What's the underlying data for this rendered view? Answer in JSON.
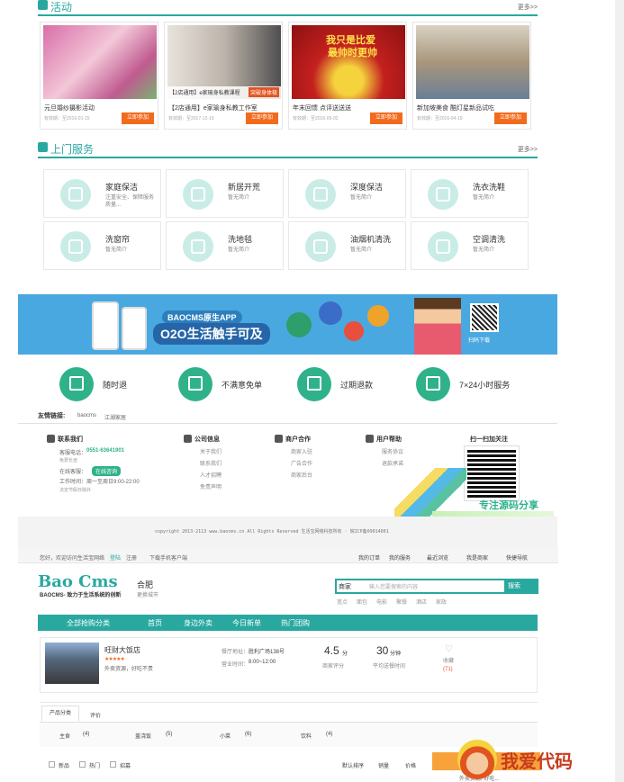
{
  "activity": {
    "title": "活动",
    "more": "更多>>",
    "items": [
      {
        "name": "元旦婚纱摄影活动",
        "date": "有效期：至2016-01-15",
        "btn": "立即参加",
        "c1": "#d86fa8",
        "c2": "#f3c7d8"
      },
      {
        "name": "【2店通用】e家瑜身私教工作室",
        "date": "有效期：至2017-12-19",
        "btn": "立即参加",
        "c1": "#cfc7bf",
        "c2": "#5a5a5a"
      },
      {
        "name": "年末回馈 点评送送送",
        "date": "有效期：至2016-05-02",
        "btn": "立即参加",
        "c1": "#c4201f",
        "c2": "#f5d33c"
      },
      {
        "name": "新加坡美食 酷灯星新品试吃",
        "date": "有效期：至2016-04-19",
        "btn": "立即参加",
        "c1": "#c1a987",
        "c2": "#6a7f96"
      }
    ],
    "overlay_texts": [
      "【2店通用】e家瑜身私教课程",
      "突破身体极",
      "我只是比爱",
      "最帅时更帅"
    ]
  },
  "services": {
    "title": "上门服务",
    "more": "更多>>",
    "items": [
      {
        "name": "家庭保洁",
        "desc": "注重安全、保障服务质量..."
      },
      {
        "name": "新居开荒",
        "desc": "暂无简介"
      },
      {
        "name": "深度保洁",
        "desc": "暂无简介"
      },
      {
        "name": "洗衣洗鞋",
        "desc": "暂无简介"
      },
      {
        "name": "洗窗帘",
        "desc": "暂无简介"
      },
      {
        "name": "洗地毯",
        "desc": "暂无简介"
      },
      {
        "name": "油烟机清洗",
        "desc": "暂无简介"
      },
      {
        "name": "空调清洗",
        "desc": "暂无简介"
      }
    ]
  },
  "banner": {
    "app": "BAOCMS原生APP",
    "slogan": "O2O生活触手可及",
    "qr_label": "扫码下载"
  },
  "guarantees": [
    {
      "label": "随时退"
    },
    {
      "label": "不满意免单"
    },
    {
      "label": "过期退款"
    },
    {
      "label": "7×24小时服务"
    }
  ],
  "friend_links": {
    "label": "友情链接:",
    "items": [
      "baocms",
      "江湖家居"
    ]
  },
  "footer": {
    "contact": {
      "title": "联系我们",
      "phone_label": "客服电话：",
      "phone": "0551-63641901",
      "phone_note": "免费长途",
      "online_label": "在线客服：",
      "online_btn": "在线咨询",
      "hours_label": "工作时间：",
      "hours": "周一至周日9:00-22:00",
      "note": "法定节假日除外"
    },
    "columns": [
      {
        "title": "公司信息",
        "links": [
          "关于我们",
          "联系我们",
          "人才招聘",
          "免责声明"
        ]
      },
      {
        "title": "商户合作",
        "links": [
          "商家入驻",
          "广告合作",
          "商家后台"
        ]
      },
      {
        "title": "用户帮助",
        "links": [
          "服务协议",
          "退款承诺"
        ]
      }
    ],
    "qr_title": "扫一扫加关注",
    "copyright": "copyright 2013-2113 www.baocms.cn All Rights Reserved 生活宝网络科技所有 · 皖ICP备09014001",
    "watermark": "专注源码分享"
  },
  "shop": {
    "topbar": {
      "welcome": "您好，欢迎访问生活宝网络",
      "login": "登陆",
      "register": "注册",
      "mobile": "下载手机客户端",
      "links": [
        "我的订单",
        "我的服务",
        "最近浏览",
        "我是商家",
        "快捷导航"
      ]
    },
    "logo": "Bao Cms",
    "logo_sub": "BAOCMS- 致力于生活系统的创新",
    "city": "合肥",
    "city_switch": "更换城市",
    "search": {
      "scope": "商家",
      "placeholder": "输入您要搜索的内容",
      "button": "搜索",
      "hot": [
        "宽点",
        "面包",
        "电影",
        "聚餐",
        "酒店",
        "家政"
      ]
    },
    "nav": [
      "全部抢购分类",
      "首页",
      "身边外卖",
      "今日新单",
      "热门团购"
    ],
    "store": {
      "name": "旺财大饭店",
      "tags": "外卖资源，好吃不贵",
      "address_label": "餐厅地址：",
      "address": "胜利广场138号",
      "hours_label": "营业时间：",
      "hours": "8:00~12:00",
      "rating": "4.5",
      "rating_unit": "分",
      "rating_label": "商家评分",
      "delivery": "30",
      "delivery_unit": "分钟",
      "delivery_label": "平均送餐时间",
      "fav": "收藏",
      "fav_count": "(71)"
    },
    "tabs": [
      "产品分类",
      "评价"
    ],
    "categories": [
      {
        "name": "主食",
        "count": "(4)"
      },
      {
        "name": "盖浇饭",
        "count": "(5)"
      },
      {
        "name": "小菜",
        "count": "(6)"
      },
      {
        "name": "饮料",
        "count": "(4)"
      }
    ],
    "filters": [
      "新品",
      "热门",
      "招募"
    ],
    "sort": [
      "默认排序",
      "销量",
      "价格"
    ],
    "cart_hint": "外卖资源, 好吃..."
  },
  "watermark_brand": "我爱代码",
  "colors": {
    "teal": "#29a8a0",
    "orange": "#f26b1d",
    "green": "#2fb28a"
  }
}
